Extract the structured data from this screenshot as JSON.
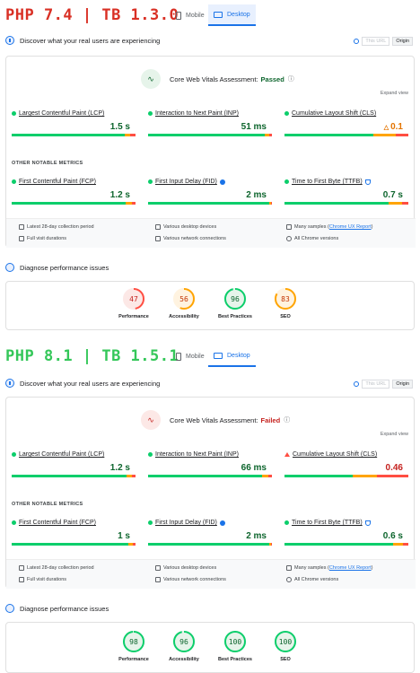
{
  "top": {
    "title": "PHP 7.4 | TB 1.3.0",
    "tab_mobile": "Mobile",
    "tab_desktop": "Desktop",
    "discover": "Discover what your real users are experiencing",
    "toggle_this": "This URL",
    "toggle_origin": "Origin",
    "assess_label": "Core Web Vitals Assessment:",
    "assess_status": "Passed",
    "expand": "Expand view",
    "metrics": [
      {
        "label": "Largest Contentful Paint (LCP)",
        "value": "1.5 s",
        "status": "good"
      },
      {
        "label": "Interaction to Next Paint (INP)",
        "value": "51 ms",
        "status": "good"
      },
      {
        "label": "Cumulative Layout Shift (CLS)",
        "value": "0.1",
        "status": "needs-improvement"
      }
    ],
    "other": "OTHER NOTABLE METRICS",
    "others": [
      {
        "label": "First Contentful Paint (FCP)",
        "value": "1.2 s"
      },
      {
        "label": "First Input Delay (FID)",
        "value": "2 ms"
      },
      {
        "label": "Time to First Byte (TTFB)",
        "value": "0.7 s"
      }
    ],
    "foot": {
      "a": "Latest 28-day collection period",
      "b": "Various desktop devices",
      "c": "Many samples (",
      "c_link": "Chrome UX Report",
      "c_end": ")",
      "d": "Full visit durations",
      "e": "Various network connections",
      "f": "All Chrome versions"
    },
    "diagnose": "Diagnose performance issues",
    "scores": [
      {
        "label": "Performance",
        "value": "47",
        "score": 47,
        "color": "#ff4e42",
        "bg": "#fce8e6"
      },
      {
        "label": "Accessibility",
        "value": "56",
        "score": 56,
        "color": "#ffa400",
        "bg": "#fff3e0"
      },
      {
        "label": "Best Practices",
        "value": "96",
        "score": 96,
        "color": "#0cce6b",
        "bg": "#e6f4ea"
      },
      {
        "label": "SEO",
        "value": "83",
        "score": 83,
        "color": "#ffa400",
        "bg": "#fff3e0"
      }
    ]
  },
  "bottom": {
    "title": "PHP 8.1 | TB 1.5.1",
    "tab_mobile": "Mobile",
    "tab_desktop": "Desktop",
    "discover": "Discover what your real users are experiencing",
    "toggle_this": "This URL",
    "toggle_origin": "Origin",
    "assess_label": "Core Web Vitals Assessment:",
    "assess_status": "Failed",
    "expand": "Expand view",
    "metrics": [
      {
        "label": "Largest Contentful Paint (LCP)",
        "value": "1.2 s",
        "status": "good"
      },
      {
        "label": "Interaction to Next Paint (INP)",
        "value": "66 ms",
        "status": "good"
      },
      {
        "label": "Cumulative Layout Shift (CLS)",
        "value": "0.46",
        "status": "poor"
      }
    ],
    "other": "OTHER NOTABLE METRICS",
    "others": [
      {
        "label": "First Contentful Paint (FCP)",
        "value": "1 s"
      },
      {
        "label": "First Input Delay (FID)",
        "value": "2 ms"
      },
      {
        "label": "Time to First Byte (TTFB)",
        "value": "0.6 s"
      }
    ],
    "foot": {
      "a": "Latest 28-day collection period",
      "b": "Various desktop devices",
      "c": "Many samples (",
      "c_link": "Chrome UX Report",
      "c_end": ")",
      "d": "Full visit durations",
      "e": "Various network connections",
      "f": "All Chrome versions"
    },
    "diagnose": "Diagnose performance issues",
    "scores": [
      {
        "label": "Performance",
        "value": "98",
        "score": 98,
        "color": "#0cce6b",
        "bg": "#e6f4ea"
      },
      {
        "label": "Accessibility",
        "value": "96",
        "score": 96,
        "color": "#0cce6b",
        "bg": "#e6f4ea"
      },
      {
        "label": "Best Practices",
        "value": "100",
        "score": 100,
        "color": "#0cce6b",
        "bg": "#e6f4ea"
      },
      {
        "label": "SEO",
        "value": "100",
        "score": 100,
        "color": "#0cce6b",
        "bg": "#e6f4ea"
      }
    ]
  }
}
